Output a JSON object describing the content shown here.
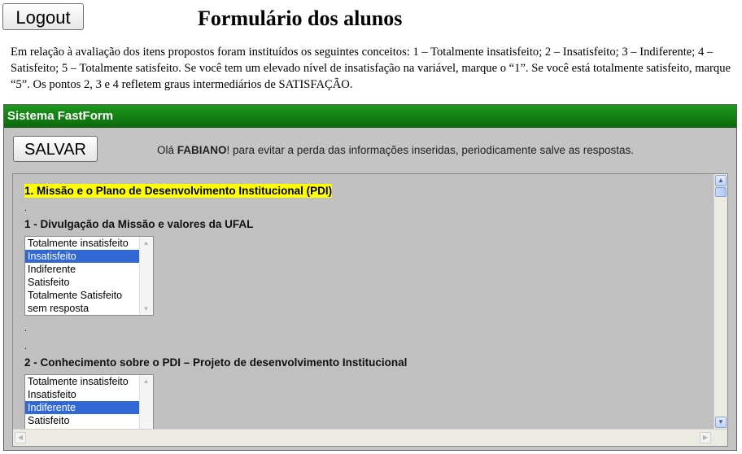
{
  "header": {
    "logout_label": "Logout",
    "title": "Formulário dos alunos"
  },
  "intro_text": "Em relação à avaliação dos itens propostos foram instituídos os seguintes conceitos: 1 – Totalmente insatisfeito; 2 – Insatisfeito; 3 – Indiferente; 4 – Satisfeito; 5 – Totalmente satisfeito. Se você tem um elevado nível de insatisfação na variável, marque o “1”. Se você está totalmente satisfeito, marque “5”. Os pontos 2, 3 e 4 refletem graus intermediários de SATISFAÇÃO.",
  "panel": {
    "title": "Sistema FastForm",
    "save_label": "SALVAR",
    "greeting_prefix": "Olá ",
    "user_name": "FABIANO",
    "greeting_suffix": "! para evitar a perda das informações inseridas, periodicamente salve as respostas."
  },
  "form": {
    "section_title": "1. Missão e o Plano de Desenvolvimento Institucional (PDI)",
    "dot": ".",
    "questions": [
      {
        "title": "1 - Divulgação da Missão e valores da UFAL",
        "options": [
          "Totalmente insatisfeito",
          "Insatisfeito",
          "Indiferente",
          "Satisfeito",
          "Totalmente Satisfeito",
          "sem resposta"
        ],
        "selected": "Insatisfeito"
      },
      {
        "title": "2 - Conhecimento sobre o PDI – Projeto de desenvolvimento Institucional",
        "options": [
          "Totalmente insatisfeito",
          "Insatisfeito",
          "Indiferente",
          "Satisfeito"
        ],
        "selected": "Indiferente"
      }
    ]
  }
}
